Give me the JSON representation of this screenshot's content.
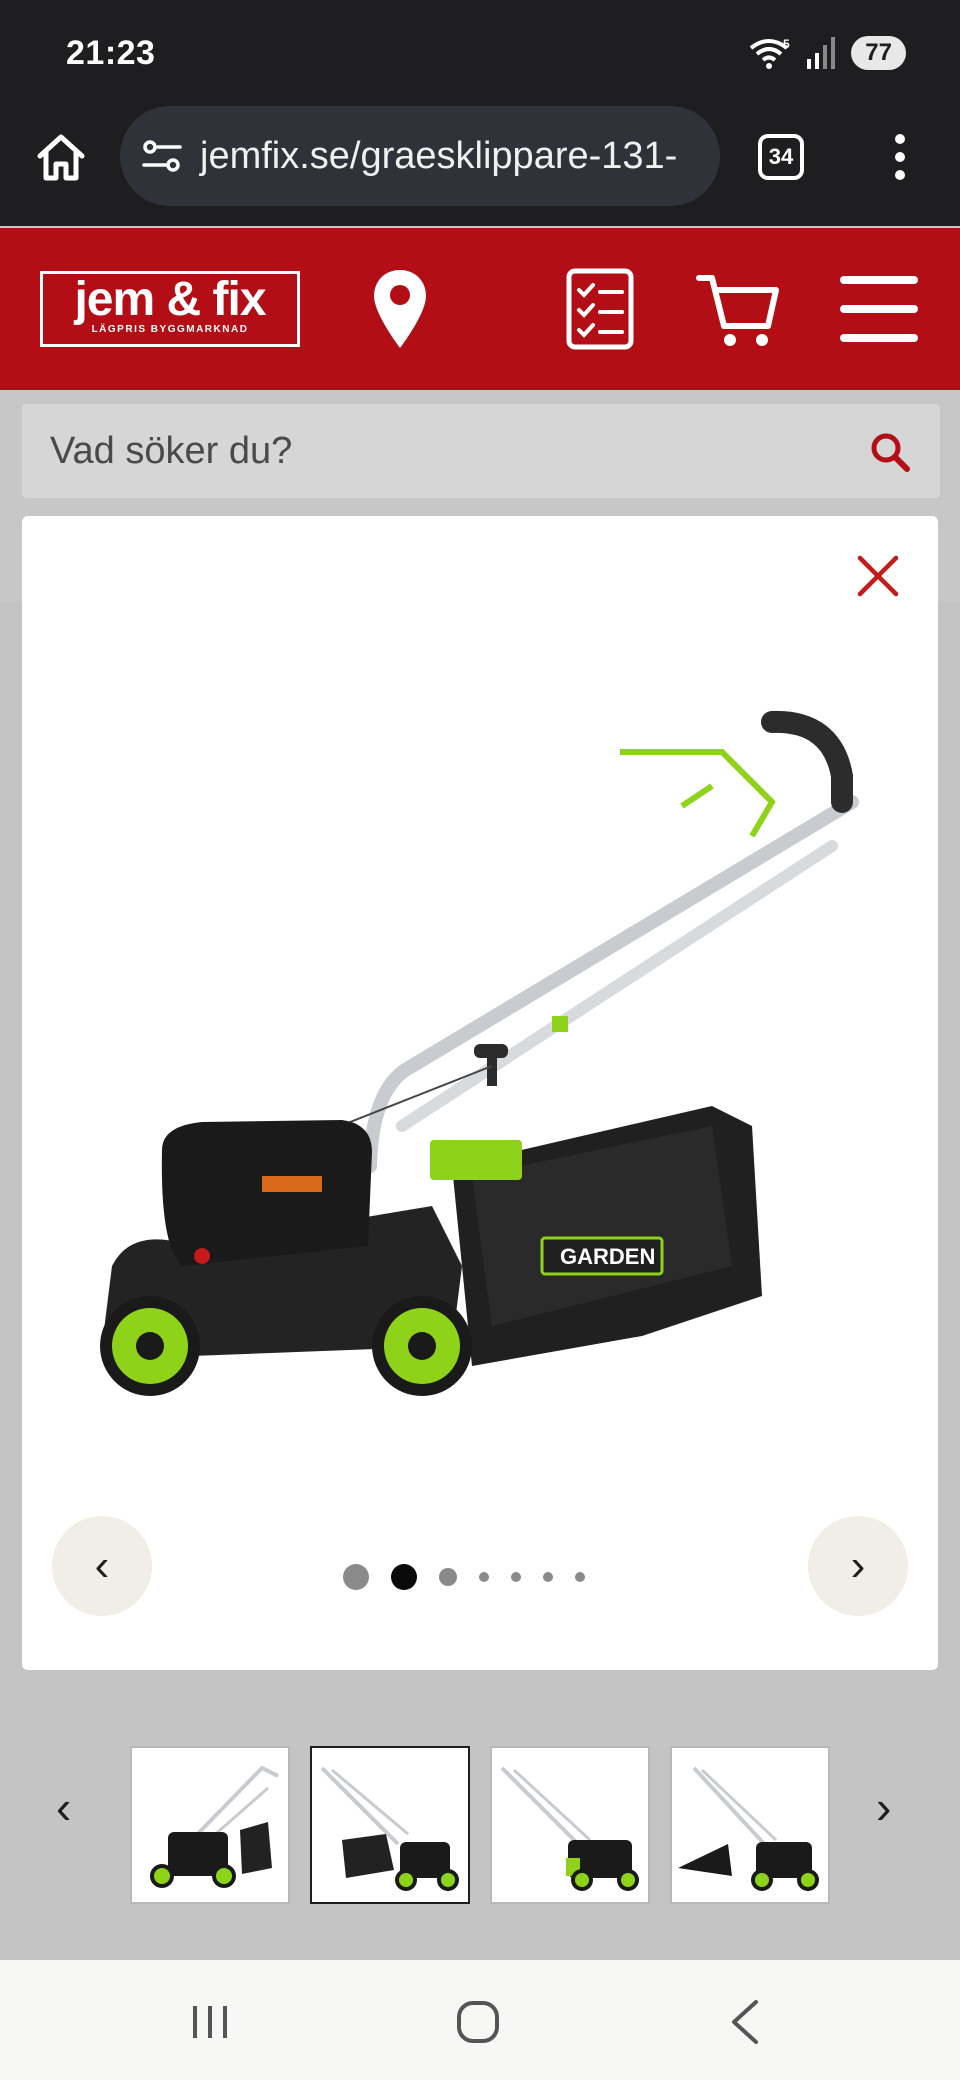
{
  "status_bar": {
    "time": "21:23",
    "wifi_label": "5",
    "battery": "77"
  },
  "browser": {
    "url": "jemfix.se/graesklippare-131-",
    "tab_count": "34"
  },
  "header": {
    "logo_text": "jem & fix",
    "logo_tagline": "LÄGPRIS BYGGMARKNAD"
  },
  "search": {
    "placeholder": "Vad söker du?"
  },
  "gallery": {
    "prev_label": "‹",
    "next_label": "›",
    "active_index": 1,
    "dot_count": 7,
    "product_brand_on_bag": "GARDEN",
    "colors": {
      "accent_red": "#b30e16",
      "lawn_green": "#8fd21a"
    }
  },
  "thumbnails": {
    "prev_label": "‹",
    "next_label": "›",
    "items": [
      "thumb-1",
      "thumb-2",
      "thumb-3",
      "thumb-4"
    ],
    "active_index": 1
  }
}
